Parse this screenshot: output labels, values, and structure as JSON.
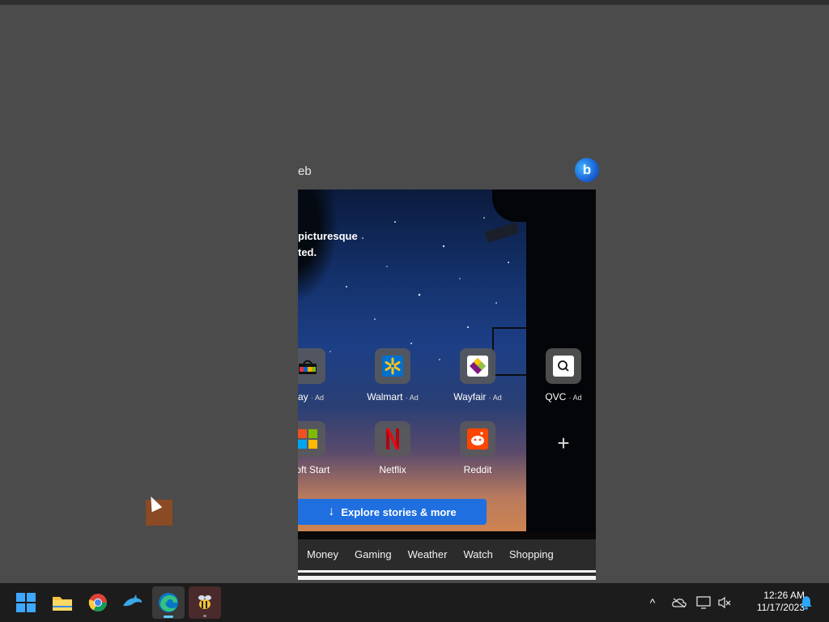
{
  "search": {
    "partial_text": "eb"
  },
  "bing": {
    "label": "b",
    "icon": "bing-chat-icon"
  },
  "hero": {
    "caption_line1": "picturesque",
    "caption_line2": "ted."
  },
  "tiles_row1": [
    {
      "name": "ebay",
      "label": "Bay",
      "ad": "· Ad",
      "icon": "ebay-bag-icon"
    },
    {
      "name": "walmart",
      "label": "Walmart",
      "ad": "· Ad",
      "icon": "walmart-spark-icon"
    },
    {
      "name": "wayfair",
      "label": "Wayfair",
      "ad": "· Ad",
      "icon": "wayfair-icon"
    },
    {
      "name": "qvc",
      "label": "QVC",
      "ad": "· Ad",
      "icon": "qvc-icon"
    }
  ],
  "tiles_row2": [
    {
      "name": "microsoft-start",
      "label": "osoft Start",
      "icon": "microsoft-logo-icon"
    },
    {
      "name": "netflix",
      "label": "Netflix",
      "icon": "netflix-icon"
    },
    {
      "name": "reddit",
      "label": "Reddit",
      "icon": "reddit-icon"
    },
    {
      "name": "add-site",
      "label": "+",
      "icon": "plus-icon"
    }
  ],
  "explore": {
    "arrow": "↓",
    "label": "Explore stories & more"
  },
  "tabs": [
    "Money",
    "Gaming",
    "Weather",
    "Watch",
    "Shopping"
  ],
  "taskbar": {
    "apps": [
      "windows-start-icon",
      "file-explorer-icon",
      "chrome-icon",
      "dolphin-icon",
      "edge-icon",
      "bee-app-icon"
    ]
  },
  "tray": {
    "chevron": "^",
    "time": "12:26 AM",
    "date": "11/17/2023"
  },
  "colors": {
    "accent": "#1f6fe0",
    "taskbar": "#1c1c1c",
    "desktop": "#4b4b4b",
    "netflix": "#e50914",
    "reddit": "#ff4500",
    "walmart": "#0071ce"
  }
}
